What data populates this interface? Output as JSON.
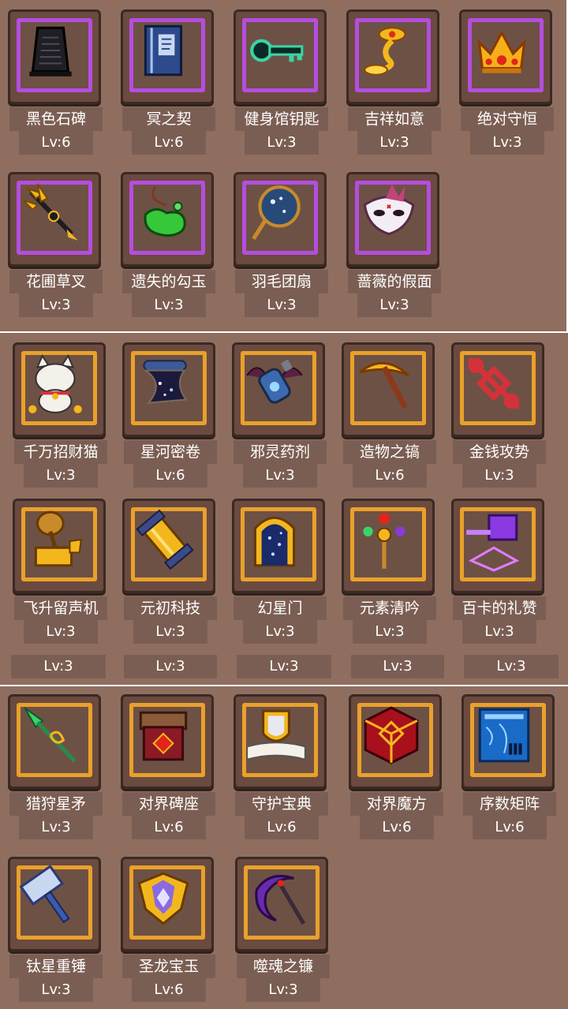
{
  "colors": {
    "background": "#8f6e60",
    "purple_border": "#b54de0",
    "gold_border": "#e9a12b"
  },
  "top_items": [
    {
      "name": "黑色石碑",
      "level": "Lv:6",
      "icon": "black-stele-icon"
    },
    {
      "name": "冥之契",
      "level": "Lv:6",
      "icon": "blue-book-icon"
    },
    {
      "name": "健身馆钥匙",
      "level": "Lv:3",
      "icon": "green-key-icon"
    },
    {
      "name": "吉祥如意",
      "level": "Lv:3",
      "icon": "golden-ruyi-icon"
    },
    {
      "name": "绝对守恒",
      "level": "Lv:3",
      "icon": "golden-crown-icon"
    },
    {
      "name": "花圃草叉",
      "level": "Lv:3",
      "icon": "golden-pitchfork-icon"
    },
    {
      "name": "遗失的勾玉",
      "level": "Lv:3",
      "icon": "green-magatama-icon"
    },
    {
      "name": "羽毛团扇",
      "level": "Lv:3",
      "icon": "round-fan-icon"
    },
    {
      "name": "蔷薇的假面",
      "level": "Lv:3",
      "icon": "white-mask-icon"
    }
  ],
  "mid_items": [
    {
      "name": "千万招财猫",
      "level": "Lv:3",
      "icon": "lucky-cat-icon"
    },
    {
      "name": "星河密卷",
      "level": "Lv:6",
      "icon": "star-scroll-icon"
    },
    {
      "name": "邪灵药剂",
      "level": "Lv:3",
      "icon": "evil-potion-icon"
    },
    {
      "name": "造物之镐",
      "level": "Lv:6",
      "icon": "pickaxe-icon"
    },
    {
      "name": "金钱攻势",
      "level": "Lv:3",
      "icon": "red-knot-icon"
    },
    {
      "name": "飞升留声机",
      "level": "Lv:3",
      "icon": "gramophone-icon"
    },
    {
      "name": "元初科技",
      "level": "Lv:3",
      "icon": "tech-cylinder-icon"
    },
    {
      "name": "幻星门",
      "level": "Lv:3",
      "icon": "star-gate-icon"
    },
    {
      "name": "元素清吟",
      "level": "Lv:3",
      "icon": "element-staff-icon"
    },
    {
      "name": "百卡的礼赞",
      "level": "Lv:3",
      "icon": "purple-hammer-icon"
    }
  ],
  "strip_levels": [
    "Lv:3",
    "Lv:3",
    "Lv:3",
    "Lv:3",
    "Lv:3"
  ],
  "bottom_items": [
    {
      "name": "猎狩星矛",
      "level": "Lv:3",
      "icon": "green-spear-icon"
    },
    {
      "name": "对界碑座",
      "level": "Lv:6",
      "icon": "red-chest-icon"
    },
    {
      "name": "守护宝典",
      "level": "Lv:6",
      "icon": "shield-book-icon"
    },
    {
      "name": "对界魔方",
      "level": "Lv:6",
      "icon": "red-cube-icon"
    },
    {
      "name": "序数矩阵",
      "level": "Lv:6",
      "icon": "blue-panel-icon"
    },
    {
      "name": "钛星重锤",
      "level": "Lv:3",
      "icon": "blue-hammer-icon"
    },
    {
      "name": "圣龙宝玉",
      "level": "Lv:6",
      "icon": "dragon-jade-icon"
    },
    {
      "name": "噬魂之镰",
      "level": "Lv:3",
      "icon": "purple-scythe-icon"
    }
  ]
}
